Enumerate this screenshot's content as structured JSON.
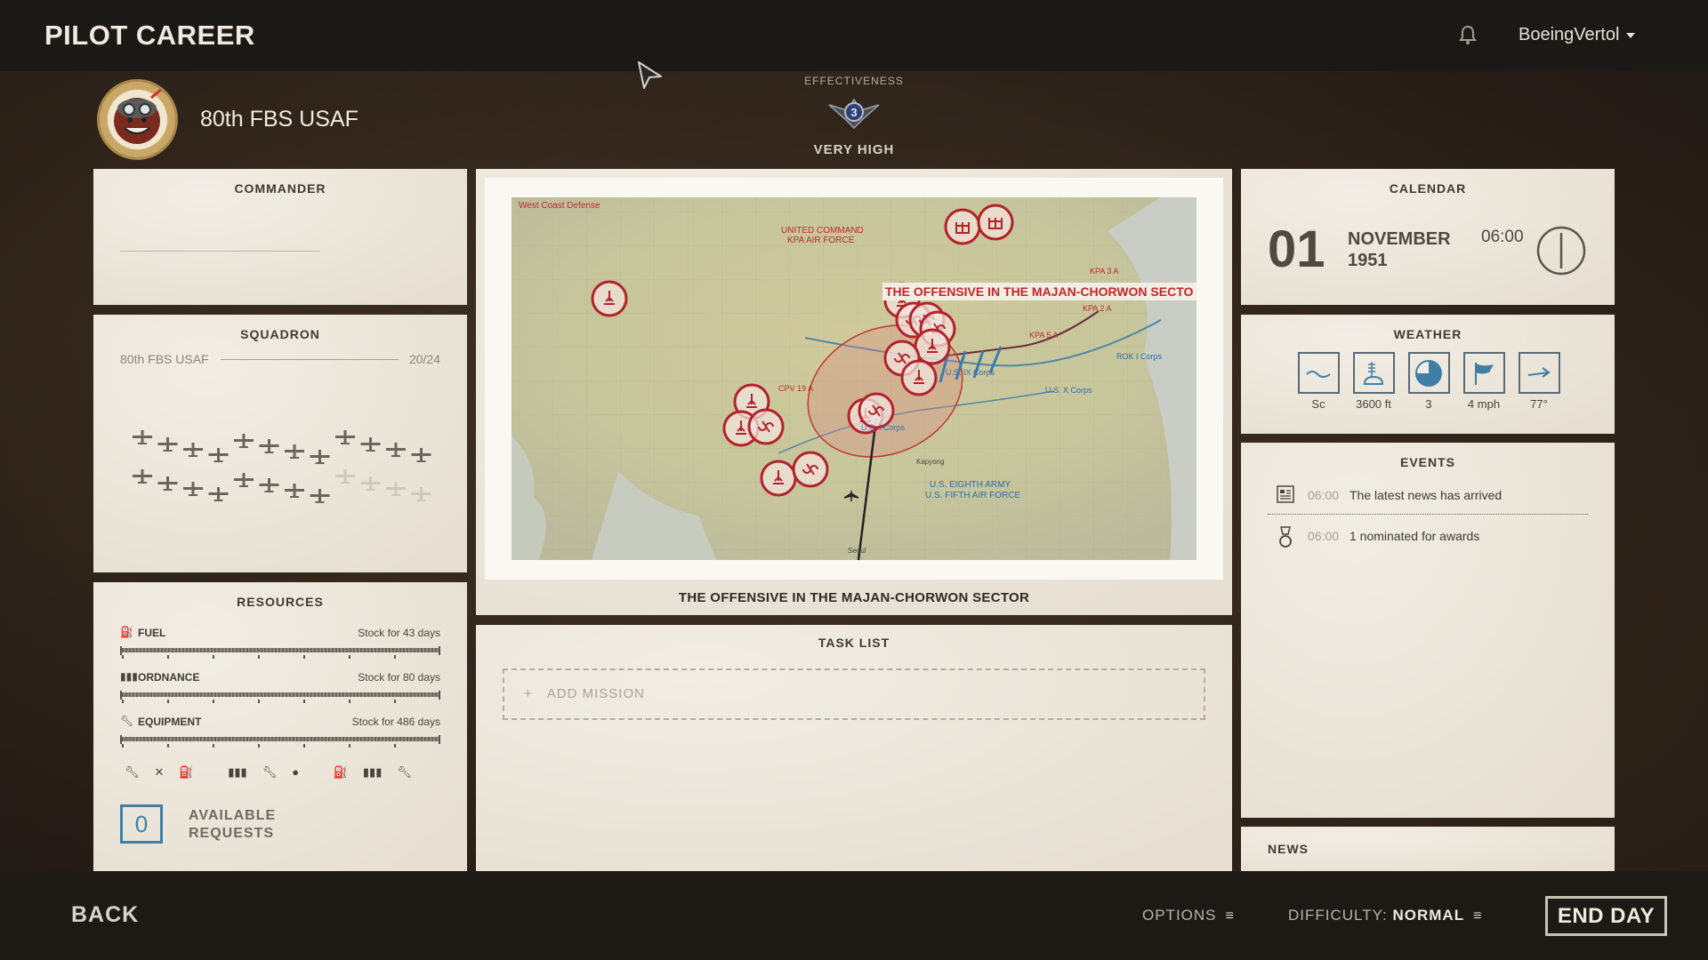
{
  "header": {
    "title": "PILOT CAREER",
    "user": "BoeingVertol"
  },
  "unit": {
    "name": "80th FBS USAF",
    "effectiveness_label": "EFFECTIVENESS",
    "effectiveness_rank": "3",
    "effectiveness_value": "VERY HIGH"
  },
  "commander": {
    "title": "COMMANDER"
  },
  "squadron": {
    "title": "SQUADRON",
    "name": "80th FBS USAF",
    "count": "20/24",
    "aircraft_total": 24,
    "aircraft_available": 20
  },
  "resources": {
    "title": "RESOURCES",
    "items": [
      {
        "label": "FUEL",
        "stock": "Stock for 43 days",
        "icon": "fuel-icon",
        "level": 1.0
      },
      {
        "label": "ORDNANCE",
        "stock": "Stock for 80 days",
        "icon": "ordnance-icon",
        "level": 1.0
      },
      {
        "label": "EQUIPMENT",
        "stock": "Stock for 486 days",
        "icon": "wrench-icon",
        "level": 1.0
      }
    ],
    "available_requests_count": "0",
    "available_requests_label": "AVAILABLE REQUESTS"
  },
  "map": {
    "operation_title": "THE OFFENSIVE IN THE MAJAN-CHORWON SECTOR",
    "map_banner": "THE OFFENSIVE IN THE MAJAN-CHORWON SECTO",
    "labels": {
      "west_coast": "West Coast Defense",
      "united_command": "UNITED COMMAND",
      "kpa_air": "KPA AIR FORCE",
      "kpa3a": "KPA 3 A",
      "kpa2a": "KPA 2 A",
      "kpa5a": "KPA 5 A",
      "cpv": "CPV 19 A",
      "us9": "U.S. IX Corps",
      "us10": "U.S. X Corps",
      "us1": "U.S. I Corps",
      "rok1": "ROK I Corps",
      "us8": "U.S. EIGHTH ARMY",
      "usaf5": "U.S. FIFTH AIR FORCE",
      "kapyong": "Kapyong",
      "seoul": "Seoul"
    }
  },
  "tasklist": {
    "title": "TASK LIST",
    "add_mission": "ADD MISSION"
  },
  "calendar": {
    "title": "CALENDAR",
    "day": "01",
    "month": "NOVEMBER",
    "year": "1951",
    "time": "06:00"
  },
  "weather": {
    "title": "WEATHER",
    "items": [
      {
        "value": "Sc",
        "icon": "cloud-type-icon"
      },
      {
        "value": "3600 ft",
        "icon": "cloud-base-icon"
      },
      {
        "value": "3",
        "icon": "cloud-cover-icon"
      },
      {
        "value": "4 mph",
        "icon": "wind-flag-icon"
      },
      {
        "value": "77°",
        "icon": "wind-direction-icon"
      }
    ]
  },
  "events": {
    "title": "EVENTS",
    "items": [
      {
        "time": "06:00",
        "text": "The latest news has arrived",
        "icon": "newspaper-icon"
      },
      {
        "time": "06:00",
        "text": "1 nominated for awards",
        "icon": "medal-icon"
      }
    ]
  },
  "news": {
    "title": "NEWS"
  },
  "footer": {
    "back": "BACK",
    "options": "OPTIONS",
    "difficulty_label": "DIFFICULTY:",
    "difficulty_value": "NORMAL",
    "end_day": "END DAY"
  },
  "colors": {
    "accent_blue": "#3f7fa6",
    "map_red": "#b3222a",
    "panel_bg": "#ede7dc"
  }
}
